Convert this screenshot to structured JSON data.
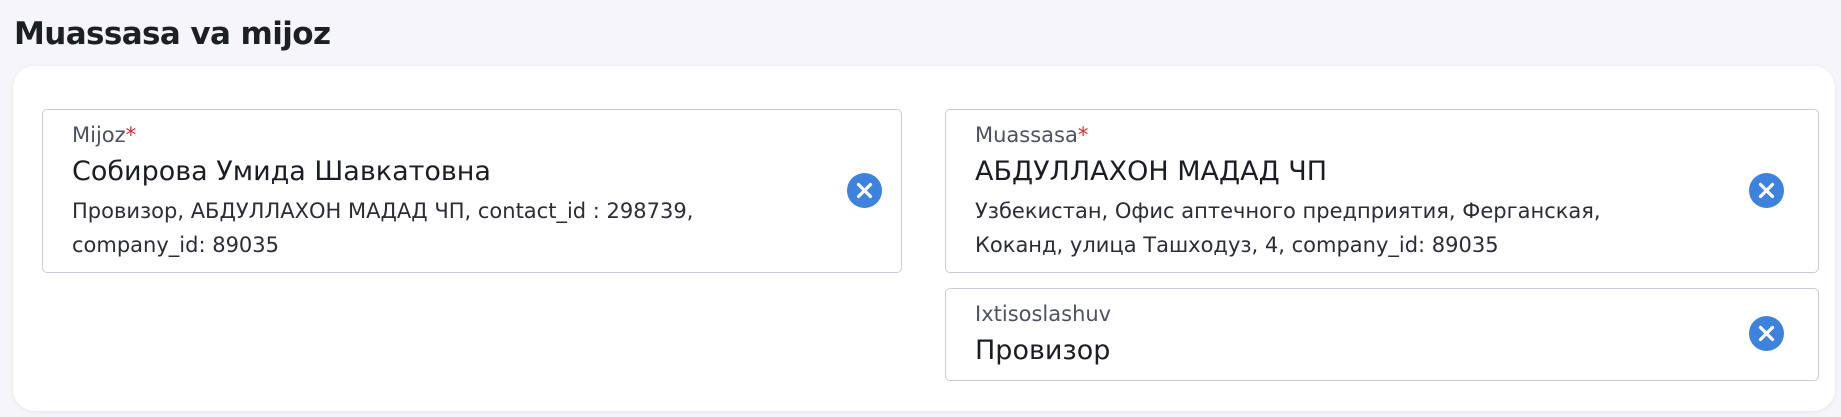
{
  "section": {
    "title": "Muassasa va mijoz"
  },
  "client_field": {
    "label": "Mijoz",
    "required_mark": "*",
    "value": "Собирова Умида Шавкатовна",
    "desc_line1": "Провизор, АБДУЛЛАХОН МАДАД ЧП, contact_id : 298739,",
    "desc_line2": "company_id: 89035",
    "clear_icon": "close-circle-icon"
  },
  "institution_field": {
    "label": "Muassasa",
    "required_mark": "*",
    "value": "АБДУЛЛАХОН МАДАД ЧП",
    "desc_line1": "Узбекистан, Офис аптечного предприятия, Ферганская,",
    "desc_line2": "Коканд, улица Ташходуз, 4, company_id: 89035",
    "clear_icon": "close-circle-icon"
  },
  "specialization_field": {
    "label": "Ixtisoslashuv",
    "value": "Провизор",
    "clear_icon": "close-circle-icon"
  },
  "colors": {
    "accent": "#3d82dd",
    "required": "#d52b2b",
    "border": "#cbcad6",
    "page_bg": "#f6f5fb"
  }
}
